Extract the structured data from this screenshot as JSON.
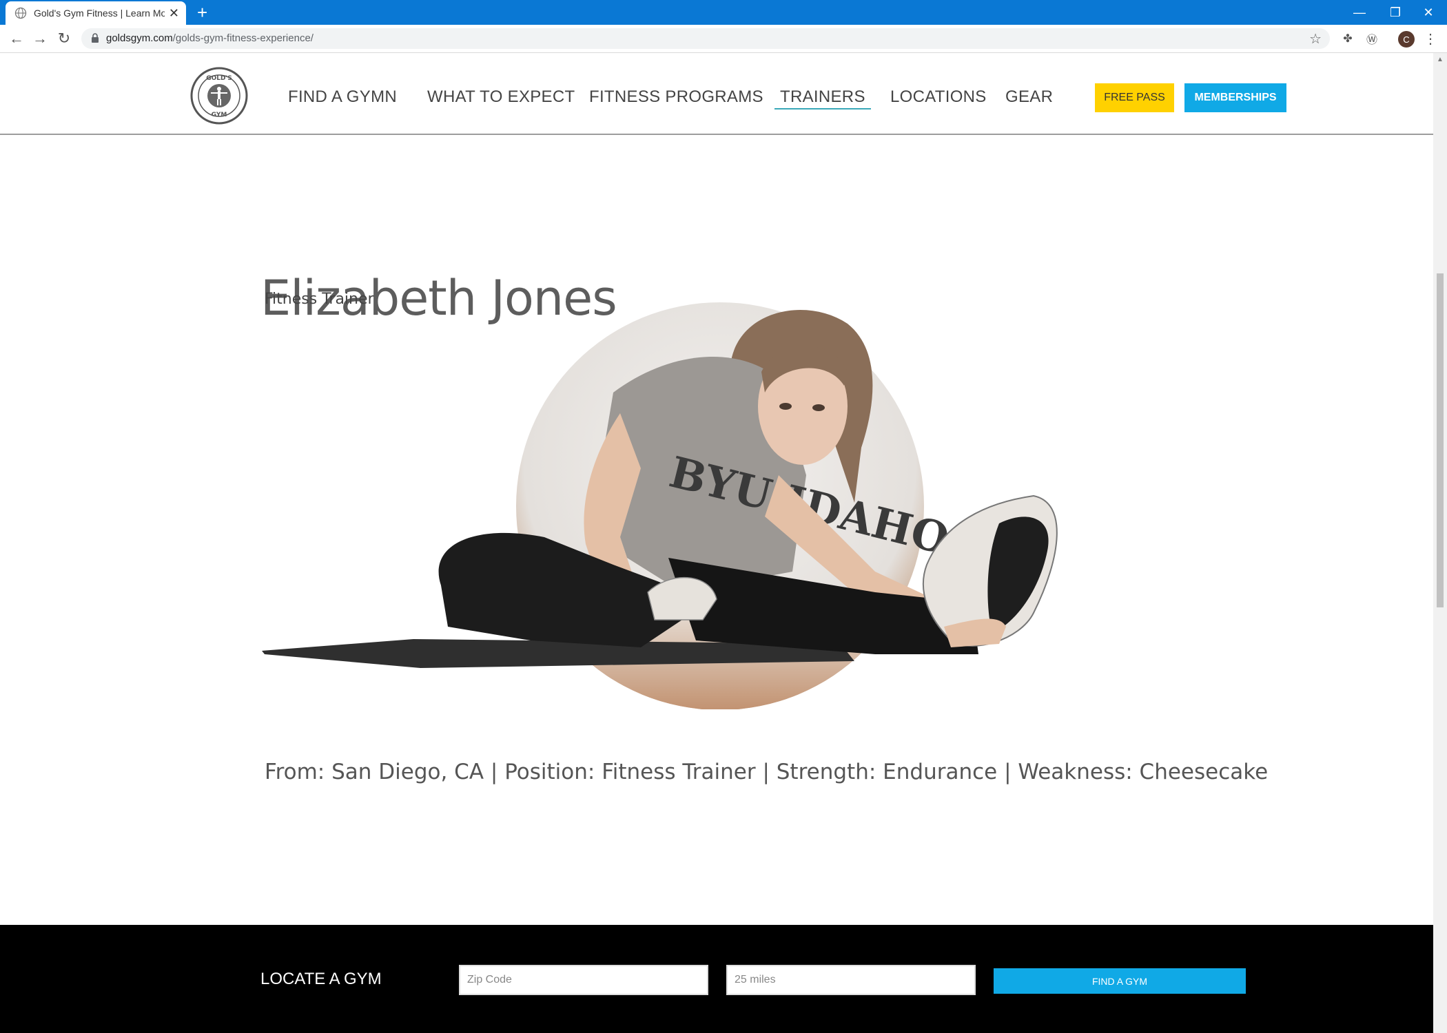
{
  "browser": {
    "tab_title": "Gold's Gym Fitness | Learn More",
    "tab_close": "✕",
    "new_tab": "+",
    "url_domain": "goldsgym.com",
    "url_path": "/golds-gym-fitness-experience/",
    "profile_initial": "C",
    "window_controls": {
      "minimize": "—",
      "restore": "❐",
      "close": "✕"
    }
  },
  "site": {
    "nav": [
      "FIND A GYMN",
      "WHAT TO EXPECT",
      "FITNESS PROGRAMS",
      "TRAINERS",
      "LOCATIONS",
      "GEAR"
    ],
    "active_nav": "TRAINERS",
    "free_pass": "FREE PASS",
    "memberships": "MEMBERSHIPS",
    "logo_text": "GOLD'S GYM"
  },
  "trainer": {
    "name": "Elizabeth Jones",
    "role": "Fitness Trainer",
    "info": "From: San Diego, CA | Position: Fitness Trainer | Strength: Endurance | Weakness: Cheesecake",
    "shirt_text": "BYU IDAHO"
  },
  "locate": {
    "title": "LOCATE A GYM",
    "zip_placeholder": "Zip Code",
    "distance_placeholder": "25 miles",
    "button": "FIND A GYM"
  },
  "colors": {
    "chrome_blue": "#0a78d4",
    "free_pass_yellow": "#ffd100",
    "membership_blue": "#10a9e6",
    "active_underline": "#3aa8b8"
  }
}
